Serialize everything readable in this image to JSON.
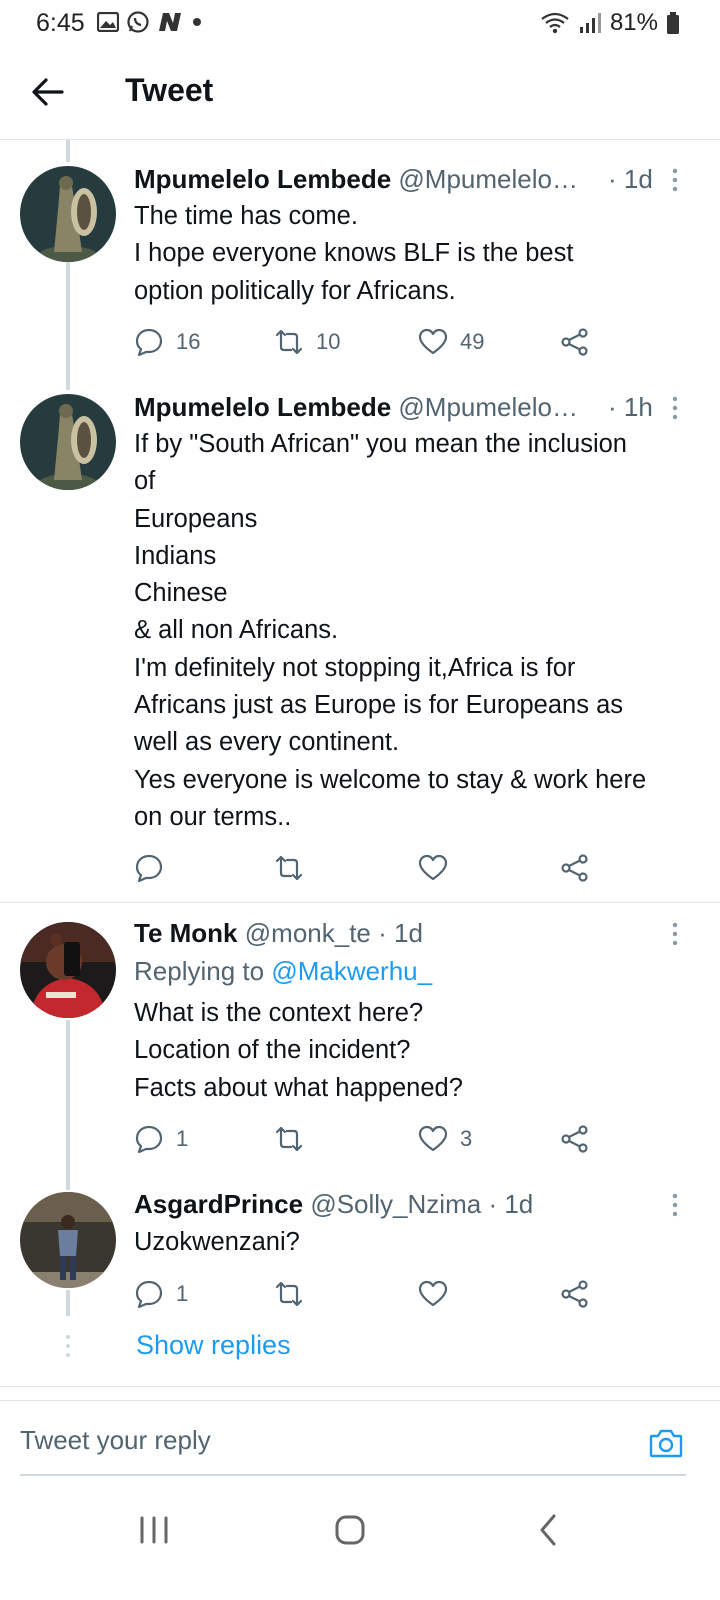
{
  "status_bar": {
    "time": "6:45",
    "battery": "81%",
    "left_icons": [
      "gallery-icon",
      "whatsapp-icon",
      "n-app-icon",
      "dot-icon"
    ],
    "right_icons": [
      "wifi-icon",
      "signal-icon",
      "battery-icon"
    ]
  },
  "header": {
    "title": "Tweet"
  },
  "tweets": [
    {
      "name": "Mpumelelo Lembede",
      "handle": "@Mpumelelo…",
      "time": "· 1d",
      "lines": [
        "The time has come.",
        "I hope everyone knows BLF is the best",
        "option politically for Africans."
      ],
      "replies": "16",
      "retweets": "10",
      "likes": "49"
    },
    {
      "name": "Mpumelelo Lembede",
      "handle": "@Mpumelelo…",
      "time": "· 1h",
      "lines": [
        "If by \"South African\" you mean the inclusion",
        "of",
        "Europeans",
        "Indians",
        "Chinese",
        "& all non Africans.",
        "I'm definitely not stopping it,Africa is for",
        "Africans just as Europe is for Europeans as",
        "well as every continent.",
        "Yes everyone is welcome to stay & work here",
        "on our terms.."
      ],
      "replies": "",
      "retweets": "",
      "likes": ""
    },
    {
      "name": "Te Monk",
      "handle": "@monk_te",
      "time": "· 1d",
      "replying_label": "Replying to",
      "replying_to": "@Makwerhu_",
      "lines": [
        "What is the context here?",
        "Location of the incident?",
        "Facts about what happened?"
      ],
      "replies": "1",
      "retweets": "",
      "likes": "3"
    },
    {
      "name": "AsgardPrince",
      "handle": "@Solly_Nzima",
      "time": "· 1d",
      "lines": [
        "Uzokwenzani?"
      ],
      "replies": "1",
      "retweets": "",
      "likes": ""
    }
  ],
  "show_replies": "Show replies",
  "reply_box": {
    "placeholder": "Tweet your reply"
  },
  "colors": {
    "accent": "#1d9bf0",
    "text": "#0f1419",
    "muted": "#536471",
    "line": "#cfd9de"
  }
}
